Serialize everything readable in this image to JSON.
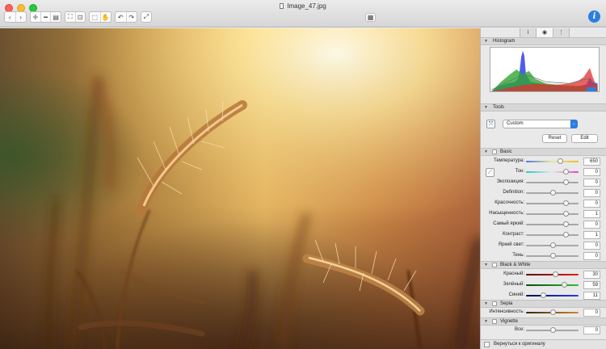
{
  "window": {
    "title": "Image_47.jpg",
    "traffic_lights": [
      "#ff5f57",
      "#febc2e",
      "#28c840"
    ]
  },
  "toolbar": {
    "nav_icons": [
      "chevron-left-icon",
      "chevron-right-icon"
    ],
    "zoom_icons": [
      "zoom-in-icon",
      "zoom-out-icon",
      "zoom-fit-icon"
    ],
    "view_icons": [
      "fit-window-icon",
      "actual-size-icon"
    ],
    "tool_icons": [
      "select-icon",
      "hand-icon"
    ],
    "rotate_icons": [
      "rotate-left-icon",
      "rotate-right-icon"
    ],
    "fullscreen_icon": "expand-icon",
    "slideshow_icon": "slideshow-icon",
    "info_label": "i"
  },
  "panel": {
    "tabs": [
      "i",
      "◉",
      "⋮"
    ],
    "histogram": {
      "title": "Histogram",
      "channel_colors": {
        "red": "#e03030",
        "green": "#2ea82e",
        "blue": "#2f3ff0",
        "gray": "#707070"
      }
    },
    "tools": {
      "title": "Tools",
      "preset": "Custom",
      "reset_label": "Reset",
      "edit_label": "Edit"
    },
    "basic": {
      "title": "Basic",
      "rows": [
        {
          "label": "Температура:",
          "value": "650",
          "fraction": 0.3,
          "track": "temp"
        },
        {
          "label": "Тон:",
          "value": "0",
          "fraction": 0.5,
          "track": "tint"
        },
        {
          "label": "Экспозиция:",
          "value": "0",
          "fraction": 0.5,
          "track": "gray"
        },
        {
          "label": "Definition:",
          "value": "0",
          "fraction": 0.0,
          "track": "gray"
        },
        {
          "label": "Красочность:",
          "value": "0",
          "fraction": 0.5,
          "track": "gray"
        },
        {
          "label": "Насыщенность:",
          "value": "1",
          "fraction": 0.5,
          "track": "gray"
        },
        {
          "label": "Самый яркий:",
          "value": "0",
          "fraction": 0.5,
          "track": "gray"
        },
        {
          "label": "Контраст:",
          "value": "1",
          "fraction": 0.5,
          "track": "gray"
        },
        {
          "label": "Яркий свет:",
          "value": "0",
          "fraction": 0.0,
          "track": "gray"
        },
        {
          "label": "Тень:",
          "value": "0",
          "fraction": 0.0,
          "track": "gray"
        }
      ]
    },
    "bw": {
      "title": "Black & White",
      "rows": [
        {
          "label": "Красный:",
          "value": "30",
          "fraction": 0.1,
          "track": "red"
        },
        {
          "label": "Зелёный:",
          "value": "59",
          "fraction": 0.45,
          "track": "green"
        },
        {
          "label": "Синий:",
          "value": "11",
          "fraction": -0.35,
          "track": "blue"
        }
      ]
    },
    "sepia": {
      "title": "Sepia",
      "rows": [
        {
          "label": "Интенсивность:",
          "value": "0",
          "fraction": 0.0,
          "track": "sepia"
        }
      ]
    },
    "vignette": {
      "title": "Vignette",
      "rows": [
        {
          "label": "Все:",
          "value": "0",
          "fraction": 0.0,
          "track": "gray"
        }
      ]
    },
    "footer": "Вернуться к оригиналу"
  }
}
